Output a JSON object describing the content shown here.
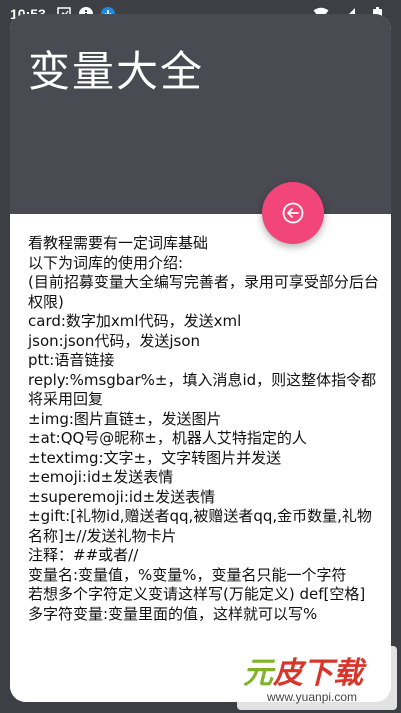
{
  "status_bar": {
    "time": "10:53",
    "icons_left": [
      "image-placeholder-icon",
      "info-icon",
      "download-icon"
    ],
    "icons_right": [
      "wifi-icon",
      "signal-icon",
      "battery-icon"
    ]
  },
  "dialog": {
    "title": "变量大全",
    "header_color": "#4a4a52",
    "fab_color": "#f2457a",
    "fab_icon": "back-arrow-circle-icon",
    "content": "看教程需要有一定词库基础\n以下为词库的使用介绍:\n(目前招募变量大全编写完善者，录用可享受部分后台权限)\ncard:数字加xml代码，发送xml\njson:json代码，发送json\nptt:语音链接\nreply:%msgbar%±，填入消息id，则这整体指令都将采用回复\n±img:图片直链±，发送图片\n±at:QQ号@昵称±，机器人艾特指定的人\n±textimg:文字±，文字转图片并发送\n±emoji:id±发送表情\n±superemoji:id±发送表情\n±gift:[礼物id,赠送者qq,被赠送者qq,金币数量,礼物名称]±//发送礼物卡片\n注释：##或者//\n变量名:变量值，%变量%，变量名只能一个字符\n若想多个字符定义变请这样写(万能定义) def[空格]多字符变量:变量里面的值，这样就可以写%"
  },
  "watermark": {
    "brand_green": "元",
    "brand_red": "皮下载",
    "url": "www.yuanpi.com"
  }
}
